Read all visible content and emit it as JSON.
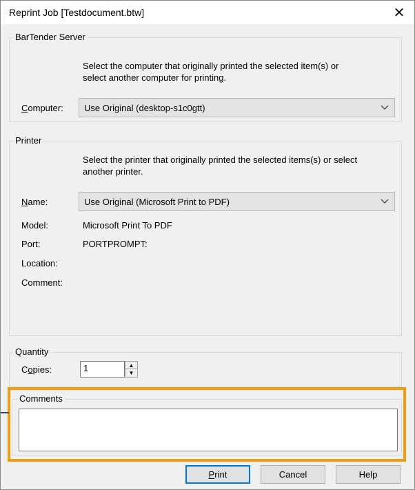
{
  "window": {
    "title": "Reprint Job [Testdocument.btw]",
    "close_glyph": "✕"
  },
  "server_group": {
    "label": "BarTender Server",
    "description_line1": "Select the computer that originally printed the selected item(s) or",
    "description_line2": "select another computer for printing.",
    "computer_label_underlined": "C",
    "computer_label_rest": "omputer:",
    "computer_value": "Use Original (desktop-s1c0gtt)"
  },
  "printer_group": {
    "label": "Printer",
    "description_line1": "Select the printer that originally printed the selected items(s) or select",
    "description_line2": "another printer.",
    "name_label_underlined": "N",
    "name_label_rest": "ame:",
    "name_value": "Use Original (Microsoft Print to PDF)",
    "model_label": "Model:",
    "model_value": "Microsoft Print To PDF",
    "port_label": "Port:",
    "port_value": "PORTPROMPT:",
    "location_label": "Location:",
    "comment_label": "Comment:"
  },
  "quantity_group": {
    "label": "Quantity",
    "copies_label_pre": "C",
    "copies_label_underlined": "o",
    "copies_label_rest": "pies:",
    "copies_value": "1"
  },
  "comments_group": {
    "label": "Comments",
    "value": ""
  },
  "buttons": {
    "print_underlined": "P",
    "print_rest": "rint",
    "cancel": "Cancel",
    "help": "Help"
  },
  "colors": {
    "highlight": "#f39c12",
    "leader": "#34495e",
    "default_button_border": "#0078d7"
  }
}
